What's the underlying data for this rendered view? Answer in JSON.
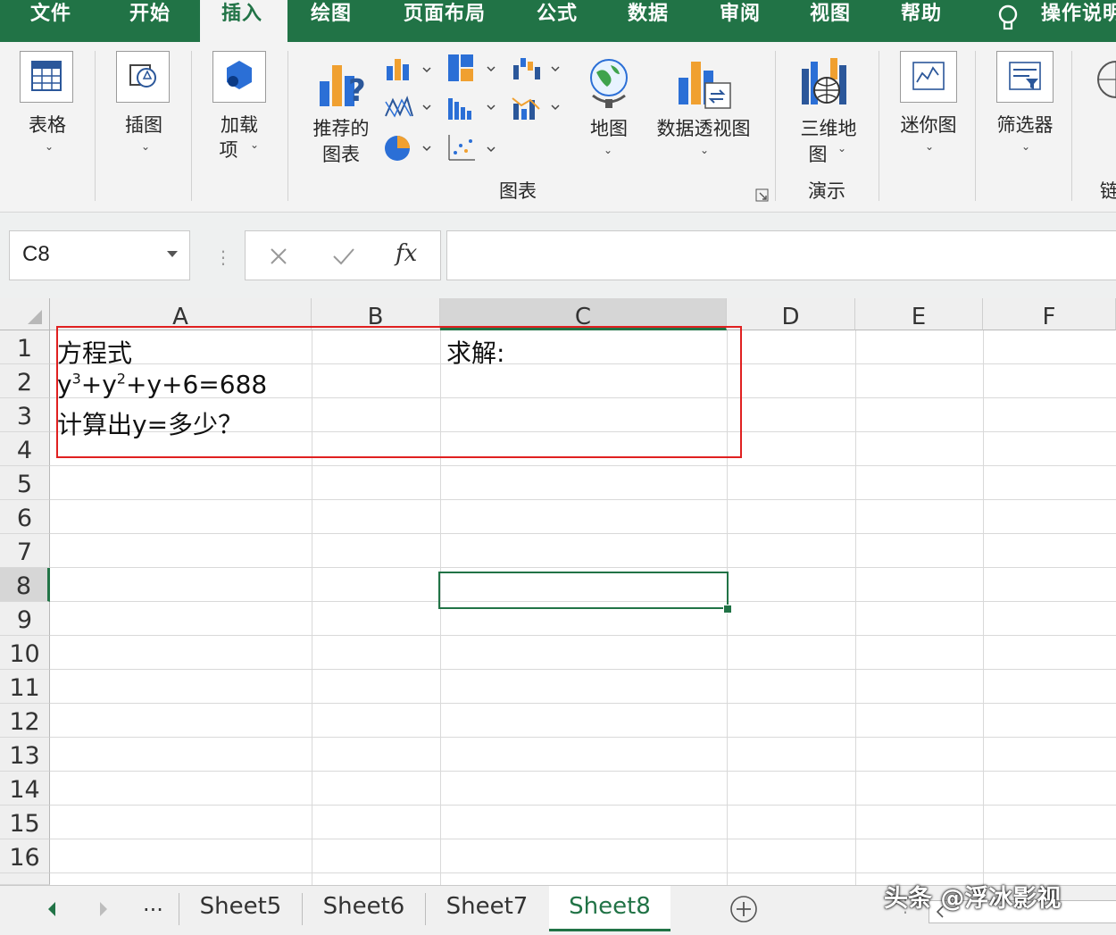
{
  "tabs": [
    "文件",
    "开始",
    "插入",
    "绘图",
    "页面布局",
    "公式",
    "数据",
    "审阅",
    "视图",
    "帮助",
    "操作说明"
  ],
  "active_tab": "插入",
  "ribbon": {
    "table": "表格",
    "illustrations": "插图",
    "addins_line1": "加载",
    "addins_line2": "项",
    "recommended_line1": "推荐的",
    "recommended_line2": "图表",
    "maps": "地图",
    "pivot_chart": "数据透视图",
    "threed_line1": "三维地",
    "threed_line2": "图",
    "sparklines": "迷你图",
    "slicer": "筛选器",
    "group_charts": "图表",
    "group_tours": "演示",
    "cut_label": "链"
  },
  "formula_bar": {
    "name_box": "C8",
    "fx": "fx",
    "content": ""
  },
  "columns": [
    "A",
    "B",
    "C",
    "D",
    "E",
    "F"
  ],
  "selected_column": "C",
  "rows": [
    "1",
    "2",
    "3",
    "4",
    "5",
    "6",
    "7",
    "8",
    "9",
    "10",
    "11",
    "12",
    "13",
    "14",
    "15",
    "16"
  ],
  "selected_row": "8",
  "cells": {
    "A1": "方程式",
    "A2_base": "y",
    "A2_exp1": "3",
    "A2_mid": "+y",
    "A2_exp2": "2",
    "A2_tail": "+y+6=688",
    "A3": "计算出y=多少？",
    "C1": "求解:"
  },
  "sheets": [
    "Sheet5",
    "Sheet6",
    "Sheet7",
    "Sheet8"
  ],
  "active_sheet": "Sheet8",
  "sheet_nav_more": "...",
  "watermark": "头条 @浮冰影视",
  "colors": {
    "accent": "#217346",
    "highlight_box": "#e02020"
  }
}
